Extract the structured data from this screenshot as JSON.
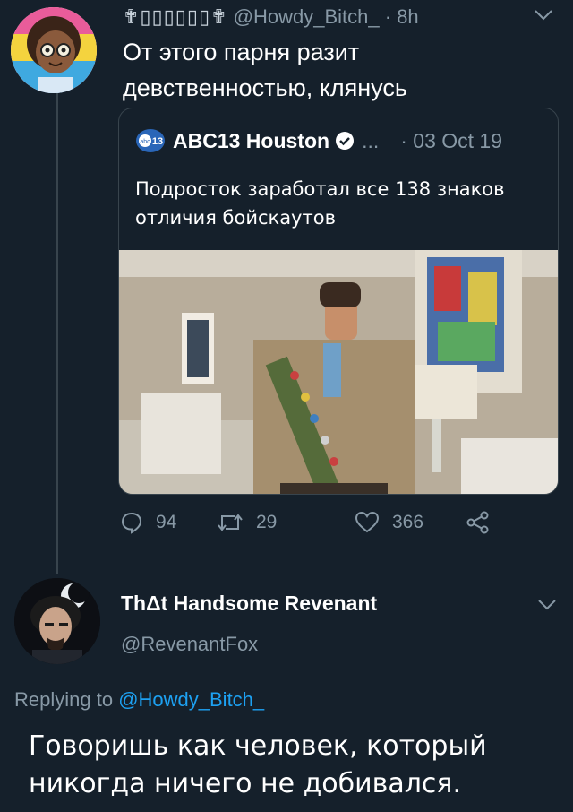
{
  "tweet1": {
    "display_name": "✟▯▯▯▯▯▯✟",
    "handle": "@Howdy_Bitch_",
    "separator": "·",
    "time": "8h",
    "text": "От этого парня разит девственностью, клянусь",
    "avatar_icon": "cartoon-girl-avatar",
    "menu_icon": "chevron-down-icon"
  },
  "quote": {
    "logo": "abc13",
    "account_name": "ABC13 Houston",
    "verified_icon": "verified-badge-icon",
    "ellipsis": "...",
    "date": "· 03 Oct 19",
    "text": "Подросток заработал все 138 знаков отличия бойскаутов",
    "photo_icon": "boy-scout-photo"
  },
  "actions": {
    "reply_count": "94",
    "retweet_count": "29",
    "like_count": "366",
    "reply_icon": "reply-icon",
    "retweet_icon": "retweet-icon",
    "like_icon": "heart-icon",
    "share_icon": "share-icon"
  },
  "tweet2": {
    "display_name": "ThΔt Handsome Revenant",
    "handle": "@RevenantFox",
    "replying_prefix": "Replying to ",
    "replying_mention": "@Howdy_Bitch_",
    "text": "Говоришь как человек, который никогда ничего не добивался.",
    "avatar_icon": "dark-avatar",
    "menu_icon": "chevron-down-icon"
  },
  "colors": {
    "background": "#15202b",
    "secondary_text": "#8899a6",
    "link": "#1da1f2",
    "border": "#38444d"
  }
}
